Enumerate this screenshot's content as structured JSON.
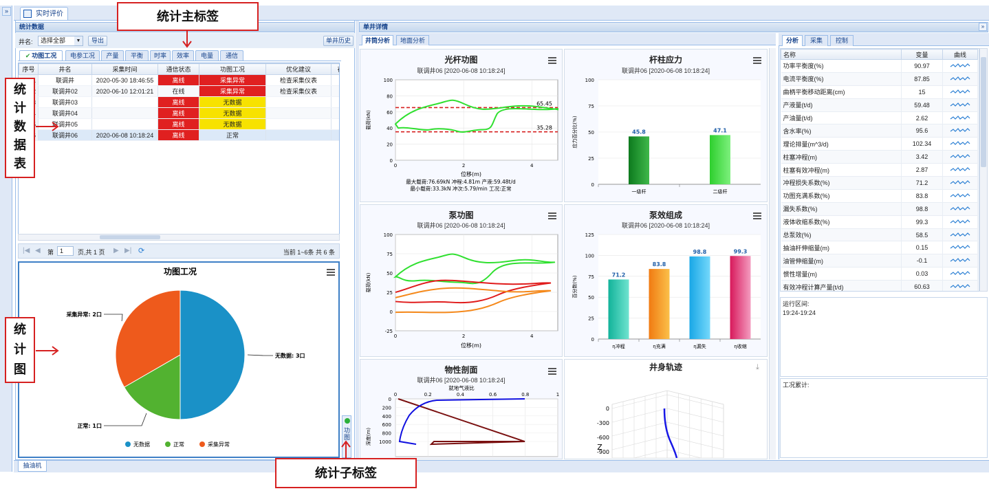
{
  "top_tab": "实时评价",
  "collapse_glyph": "»",
  "left_panel": {
    "header": "统计数据",
    "well_label": "井名:",
    "well_select": "选择全部",
    "export_btn": "导出",
    "history_btn": "单井历史",
    "tabs": [
      "功图工况",
      "电参工况",
      "产量",
      "平衡",
      "时率",
      "效率",
      "电量",
      "通信"
    ],
    "columns": [
      "序号",
      "井名",
      "采集时间",
      "通信状态",
      "功图工况",
      "优化建议",
      "在线"
    ],
    "rows": [
      {
        "no": "1",
        "name": "联调井",
        "time": "2020-05-30 18:46:55",
        "comm": "离线",
        "cond": "采集异常",
        "advice": "检查采集仪表"
      },
      {
        "no": "2",
        "name": "联调井02",
        "time": "2020-06-10 12:01:21",
        "comm": "在线",
        "cond": "采集异常",
        "advice": "检查采集仪表"
      },
      {
        "no": "3",
        "name": "联调井03",
        "time": "",
        "comm": "离线",
        "cond": "无数据",
        "advice": ""
      },
      {
        "no": "4",
        "name": "联调井04",
        "time": "",
        "comm": "离线",
        "cond": "无数据",
        "advice": ""
      },
      {
        "no": "5",
        "name": "联调井05",
        "time": "",
        "comm": "离线",
        "cond": "无数据",
        "advice": ""
      },
      {
        "no": "6",
        "name": "联调井06",
        "time": "2020-06-08 10:18:24",
        "comm": "离线",
        "cond": "正常",
        "advice": ""
      }
    ],
    "pager": {
      "page_label": "第",
      "page_value": "1",
      "page_total": "页,共 1 页",
      "summary": "当前 1~6条 共 6 条"
    },
    "bottom_tab": "抽油机",
    "vertical_tab": "功图"
  },
  "pie": {
    "chart_data": {
      "type": "pie",
      "title": "功图工况",
      "slices": [
        {
          "name": "无数据",
          "value": 3,
          "label": "无数据: 3口",
          "color": "#1a91c7"
        },
        {
          "name": "正常",
          "value": 1,
          "label": "正常: 1口",
          "color": "#52b230"
        },
        {
          "name": "采集异常",
          "value": 2,
          "label": "采集异常: 2口",
          "color": "#ee5a1c"
        }
      ]
    }
  },
  "middle": {
    "header": "单井详情",
    "tabs": [
      "井筒分析",
      "地面分析"
    ],
    "dyn": {
      "title": "光杆功图",
      "subtitle": "联调井06 [2020-06-08 10:18:24]",
      "ylabel": "载荷(kN)",
      "xlabel": "位移(m)",
      "yticks": [
        "100",
        "80",
        "60",
        "40",
        "20",
        "0"
      ],
      "xticks": [
        "0",
        "2",
        "4"
      ],
      "max_label": "65.45",
      "min_label": "35.28",
      "info1": "最大载荷:76.69kN 冲程:4.81m 产液:59.48t/d",
      "info2": "最小载荷:33.3kN 冲次:5.79/min 工况:正常"
    },
    "rod": {
      "title": "杆柱应力",
      "subtitle": "联调井06 [2020-06-08 10:18:24]",
      "chart_data": {
        "type": "bar",
        "categories": [
          "一级杆",
          "二级杆"
        ],
        "values": [
          45.8,
          47.1
        ],
        "ylabel": "应力百分比(%)",
        "ylim": [
          0,
          100
        ],
        "yticks": [
          "100",
          "75",
          "50",
          "25",
          "0"
        ]
      }
    },
    "pump": {
      "title": "泵功图",
      "subtitle": "联调井06 [2020-06-08 10:18:24]",
      "ylabel": "载荷(kN)",
      "xlabel": "位移(m)",
      "yticks": [
        "100",
        "75",
        "50",
        "25",
        "0",
        "-25"
      ],
      "xticks": [
        "0",
        "2",
        "4"
      ]
    },
    "eff": {
      "title": "泵效组成",
      "subtitle": "联调井06 [2020-06-08 10:18:24]",
      "chart_data": {
        "type": "bar",
        "categories": [
          "η冲程",
          "η充满",
          "η漏失",
          "η收缩"
        ],
        "values": [
          71.2,
          83.8,
          98.8,
          99.3
        ],
        "ylabel": "百分数(%)",
        "ylim": [
          0,
          125
        ],
        "yticks": [
          "125",
          "100",
          "75",
          "50",
          "25",
          "0"
        ]
      }
    },
    "profile": {
      "title": "物性剖面",
      "subtitle": "联调井06 [2020-06-08 10:18:24]",
      "top_axis_label": "就地气液比",
      "top_ticks": [
        "0",
        "0.2",
        "0.4",
        "0.6",
        "0.8",
        "1"
      ],
      "yticks": [
        "0",
        "200",
        "400",
        "600",
        "800",
        "1000"
      ],
      "ylabel": "深度(m)"
    },
    "traj": {
      "title": "井身轨迹",
      "zticks": [
        "0",
        "-300",
        "-600",
        "-900"
      ],
      "zlabel": "Z"
    }
  },
  "right": {
    "tabs": [
      "分析",
      "采集",
      "控制"
    ],
    "columns": [
      "名称",
      "变量",
      "曲线"
    ],
    "rows": [
      {
        "name": "功率平衡度(%)",
        "value": "90.97"
      },
      {
        "name": "电流平衡度(%)",
        "value": "87.85"
      },
      {
        "name": "曲柄平衡移动距离(cm)",
        "value": "15"
      },
      {
        "name": "产液量(t/d)",
        "value": "59.48"
      },
      {
        "name": "产油量(t/d)",
        "value": "2.62"
      },
      {
        "name": "含水率(%)",
        "value": "95.6"
      },
      {
        "name": "理论排量(m^3/d)",
        "value": "102.34"
      },
      {
        "name": "柱塞冲程(m)",
        "value": "3.42"
      },
      {
        "name": "柱塞有效冲程(m)",
        "value": "2.87"
      },
      {
        "name": "冲程损失系数(%)",
        "value": "71.2"
      },
      {
        "name": "功图充满系数(%)",
        "value": "83.8"
      },
      {
        "name": "漏失系数(%)",
        "value": "98.8"
      },
      {
        "name": "液体收缩系数(%)",
        "value": "99.3"
      },
      {
        "name": "总泵效(%)",
        "value": "58.5"
      },
      {
        "name": "抽油杆伸缩量(m)",
        "value": "0.15"
      },
      {
        "name": "油管伸缩量(m)",
        "value": "-0.1"
      },
      {
        "name": "惯性增量(m)",
        "value": "0.03"
      },
      {
        "name": "有效冲程计算产量(t/d)",
        "value": "60.63"
      }
    ],
    "run_label": "运行区间:",
    "run_value": "19:24-19:24",
    "acc_label": "工况累计:"
  },
  "annotations": {
    "main_tab": "统计主标签",
    "sub_tab": "统计子标签",
    "data_table": [
      "统",
      "计",
      "数",
      "据",
      "表"
    ],
    "chart": [
      "统",
      "计",
      "图"
    ]
  }
}
